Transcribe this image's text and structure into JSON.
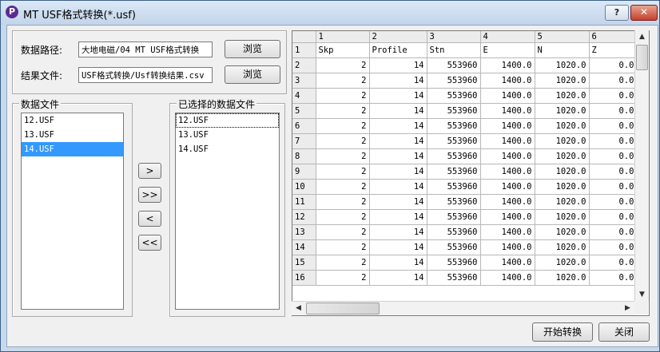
{
  "window": {
    "title": "MT USF格式转换(*.usf)",
    "help_label": "?",
    "close_label": "✕",
    "app_icon_label": "P"
  },
  "paths": {
    "data_path_label": "数据路径:",
    "data_path_value": "大地电磁/04 MT USF格式转换",
    "result_file_label": "结果文件:",
    "result_file_value": "USF格式转换/Usf转换结果.csv",
    "browse_label": "浏览"
  },
  "data_files": {
    "title": "数据文件",
    "items": [
      "12.USF",
      "13.USF",
      "14.USF"
    ],
    "selected_index": 2
  },
  "selected_files": {
    "title": "已选择的数据文件",
    "items": [
      "12.USF",
      "13.USF",
      "14.USF"
    ],
    "focused_index": 0
  },
  "transfer": {
    "add_one": ">",
    "add_all": ">>",
    "remove_one": "<",
    "remove_all": "<<"
  },
  "grid": {
    "columns": [
      "1",
      "2",
      "3",
      "4",
      "5",
      "6"
    ],
    "header_row": {
      "row_label": "1",
      "cells": [
        "Skp",
        "Profile",
        "Stn",
        "E",
        "N",
        "Z"
      ]
    },
    "rows": [
      {
        "row_label": "2",
        "cells": [
          "2",
          "14",
          "553960",
          "1400.0",
          "1020.0",
          "0.0"
        ]
      },
      {
        "row_label": "3",
        "cells": [
          "2",
          "14",
          "553960",
          "1400.0",
          "1020.0",
          "0.0"
        ]
      },
      {
        "row_label": "4",
        "cells": [
          "2",
          "14",
          "553960",
          "1400.0",
          "1020.0",
          "0.0"
        ]
      },
      {
        "row_label": "5",
        "cells": [
          "2",
          "14",
          "553960",
          "1400.0",
          "1020.0",
          "0.0"
        ]
      },
      {
        "row_label": "6",
        "cells": [
          "2",
          "14",
          "553960",
          "1400.0",
          "1020.0",
          "0.0"
        ]
      },
      {
        "row_label": "7",
        "cells": [
          "2",
          "14",
          "553960",
          "1400.0",
          "1020.0",
          "0.0"
        ]
      },
      {
        "row_label": "8",
        "cells": [
          "2",
          "14",
          "553960",
          "1400.0",
          "1020.0",
          "0.0"
        ]
      },
      {
        "row_label": "9",
        "cells": [
          "2",
          "14",
          "553960",
          "1400.0",
          "1020.0",
          "0.0"
        ]
      },
      {
        "row_label": "10",
        "cells": [
          "2",
          "14",
          "553960",
          "1400.0",
          "1020.0",
          "0.0"
        ]
      },
      {
        "row_label": "11",
        "cells": [
          "2",
          "14",
          "553960",
          "1400.0",
          "1020.0",
          "0.0"
        ]
      },
      {
        "row_label": "12",
        "cells": [
          "2",
          "14",
          "553960",
          "1400.0",
          "1020.0",
          "0.0"
        ]
      },
      {
        "row_label": "13",
        "cells": [
          "2",
          "14",
          "553960",
          "1400.0",
          "1020.0",
          "0.0"
        ]
      },
      {
        "row_label": "14",
        "cells": [
          "2",
          "14",
          "553960",
          "1400.0",
          "1020.0",
          "0.0"
        ]
      },
      {
        "row_label": "15",
        "cells": [
          "2",
          "14",
          "553960",
          "1400.0",
          "1020.0",
          "0.0"
        ]
      },
      {
        "row_label": "16",
        "cells": [
          "2",
          "14",
          "553960",
          "1400.0",
          "1020.0",
          "0.0"
        ]
      }
    ]
  },
  "footer": {
    "start_label": "开始转换",
    "close_label": "关闭"
  },
  "colors": {
    "titlebar": "#c3d5ea",
    "selection": "#3399ff",
    "close_button": "#c4402a"
  }
}
